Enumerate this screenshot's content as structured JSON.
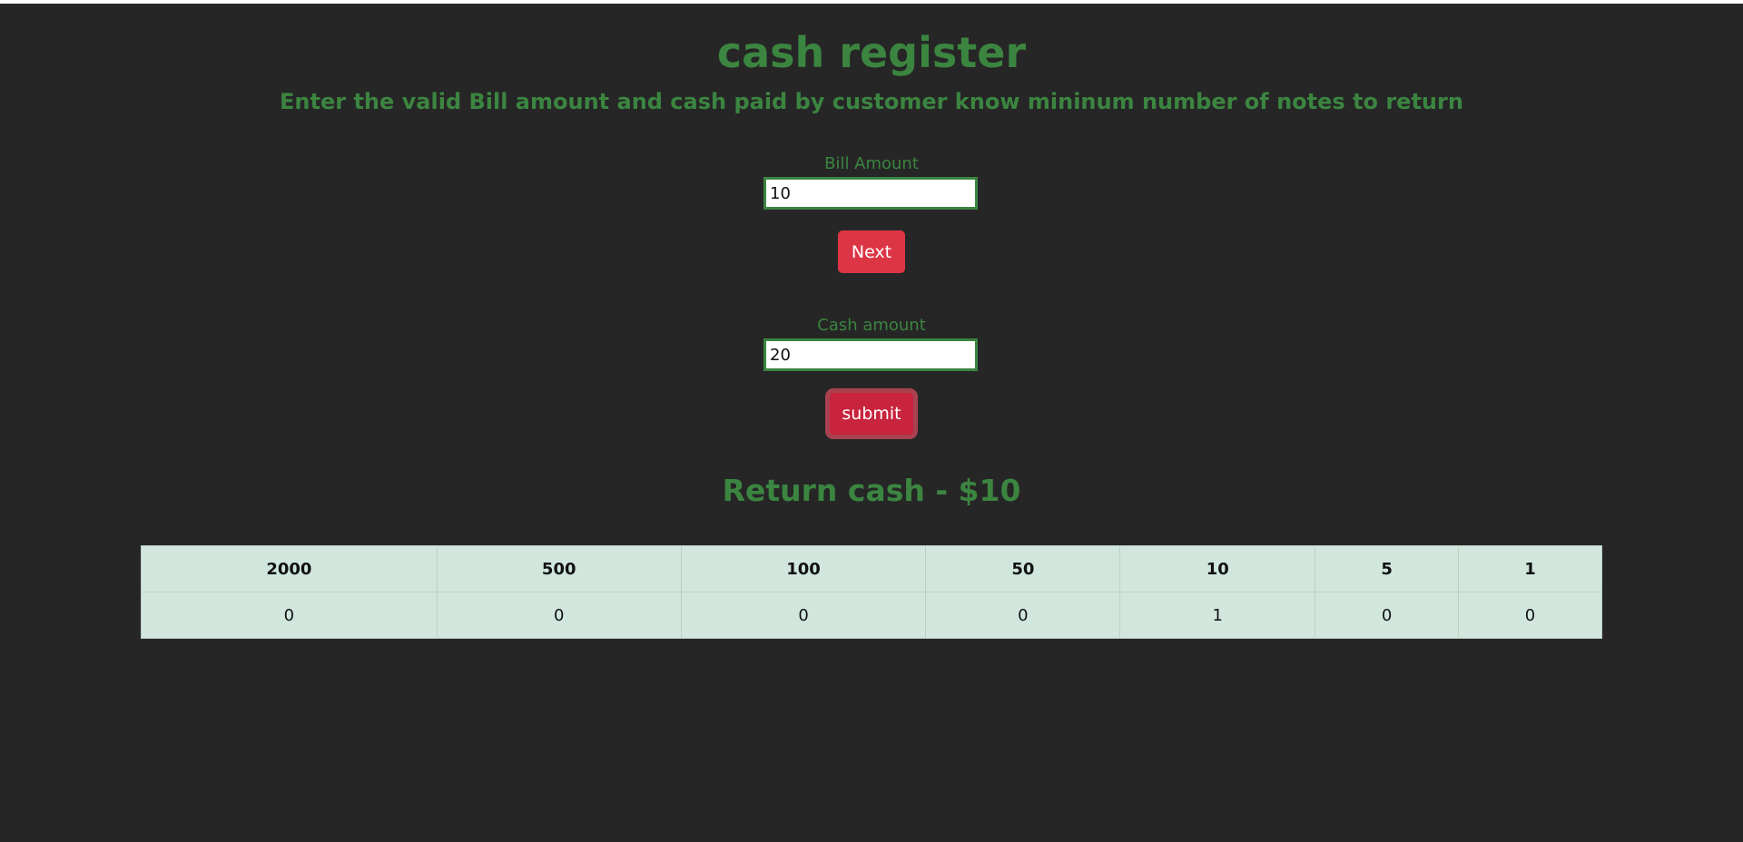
{
  "header": {
    "title": "cash register",
    "subtitle": "Enter the valid Bill amount and cash paid by customer know mininum number of notes to return"
  },
  "bill": {
    "label": "Bill Amount",
    "value": "10",
    "button_label": "Next"
  },
  "cash": {
    "label": "Cash amount",
    "value": "20",
    "button_label": "submit"
  },
  "result": {
    "text": "Return cash - $10"
  },
  "notes_table": {
    "headers": [
      "2000",
      "500",
      "100",
      "50",
      "10",
      "5",
      "1"
    ],
    "counts": [
      "0",
      "0",
      "0",
      "0",
      "1",
      "0",
      "0"
    ]
  },
  "colors": {
    "background": "#262626",
    "accent_green": "#3b8540",
    "button_red": "#dc3545",
    "table_bg": "#d1e7dd"
  }
}
